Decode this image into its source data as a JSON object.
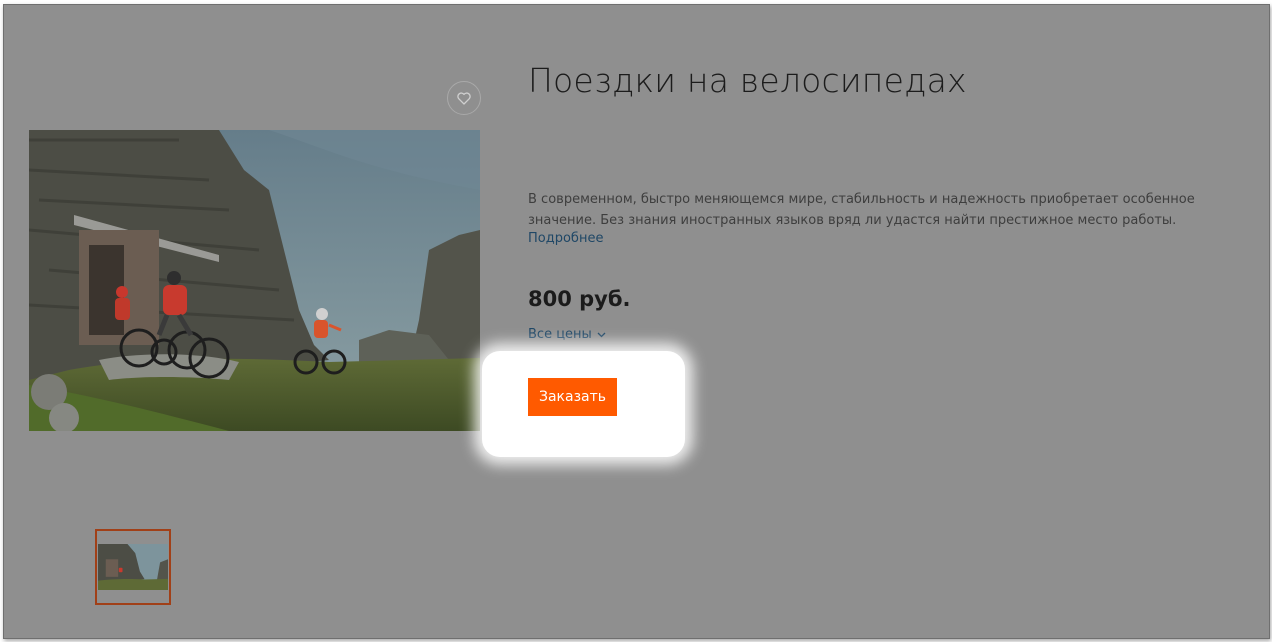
{
  "product": {
    "title": "Поездки на велосипедах",
    "description": "В современном, быстро меняющемся мире, стабильность и надежность приобретает особенное значение. Без знания иностранных языков вряд ли удастся найти престижное место работы.",
    "more_link": "Подробнее",
    "price": "800 руб.",
    "all_prices": "Все цены",
    "order_button": "Заказать"
  },
  "icons": {
    "favorite": "heart-icon",
    "dropdown": "chevron-down-icon"
  },
  "colors": {
    "overlay": "#8f8f8f",
    "accent": "#ff5a00",
    "link": "#1f4766",
    "thumb_border": "#a14018"
  }
}
